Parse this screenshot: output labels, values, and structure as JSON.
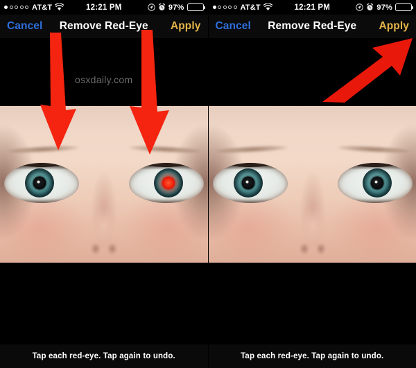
{
  "panels": [
    {
      "id": "before",
      "statusbar": {
        "signal_dots_filled": 1,
        "signal_dots_total": 5,
        "carrier": "AT&T",
        "wifi_icon": "wifi-icon",
        "time": "12:21 PM",
        "location_icon": "location-arrow-icon",
        "alarm_icon": "alarm-clock-icon",
        "battery_percent": "97%",
        "battery_level": 97,
        "battery_icon": "battery-icon"
      },
      "navbar": {
        "cancel_label": "Cancel",
        "title": "Remove Red-Eye",
        "apply_label": "Apply",
        "cancel_color": "#2d6fdc",
        "apply_color": "#e3b44a",
        "title_color": "#ffffff"
      },
      "watermark": "osxdaily.com",
      "photo": {
        "subject": "close-up of face showing both eyes",
        "left_eye_state": "corrected",
        "right_eye_state": "red-eye",
        "iris_color": "#4d8d8f",
        "redeye_color": "#f52a12"
      },
      "annotations": [
        {
          "type": "arrow-down",
          "name": "annotation-arrow-left-eye",
          "color": "#f42410"
        },
        {
          "type": "arrow-down",
          "name": "annotation-arrow-right-eye",
          "color": "#f42410"
        }
      ],
      "caption": "Tap each red-eye. Tap again to undo."
    },
    {
      "id": "after",
      "statusbar": {
        "signal_dots_filled": 1,
        "signal_dots_total": 5,
        "carrier": "AT&T",
        "wifi_icon": "wifi-icon",
        "time": "12:21 PM",
        "location_icon": "location-arrow-icon",
        "alarm_icon": "alarm-clock-icon",
        "battery_percent": "97%",
        "battery_level": 97,
        "battery_icon": "battery-icon"
      },
      "navbar": {
        "cancel_label": "Cancel",
        "title": "Remove Red-Eye",
        "apply_label": "Apply",
        "cancel_color": "#2d6fdc",
        "apply_color": "#e3b44a",
        "title_color": "#ffffff"
      },
      "watermark": "",
      "photo": {
        "subject": "close-up of face showing both eyes",
        "left_eye_state": "corrected",
        "right_eye_state": "corrected",
        "iris_color": "#4d8d8f",
        "redeye_color": "#f52a12"
      },
      "annotations": [
        {
          "type": "arrow-diagonal",
          "name": "annotation-arrow-apply-button",
          "color": "#e8180a"
        }
      ],
      "caption": "Tap each red-eye. Tap again to undo."
    }
  ]
}
